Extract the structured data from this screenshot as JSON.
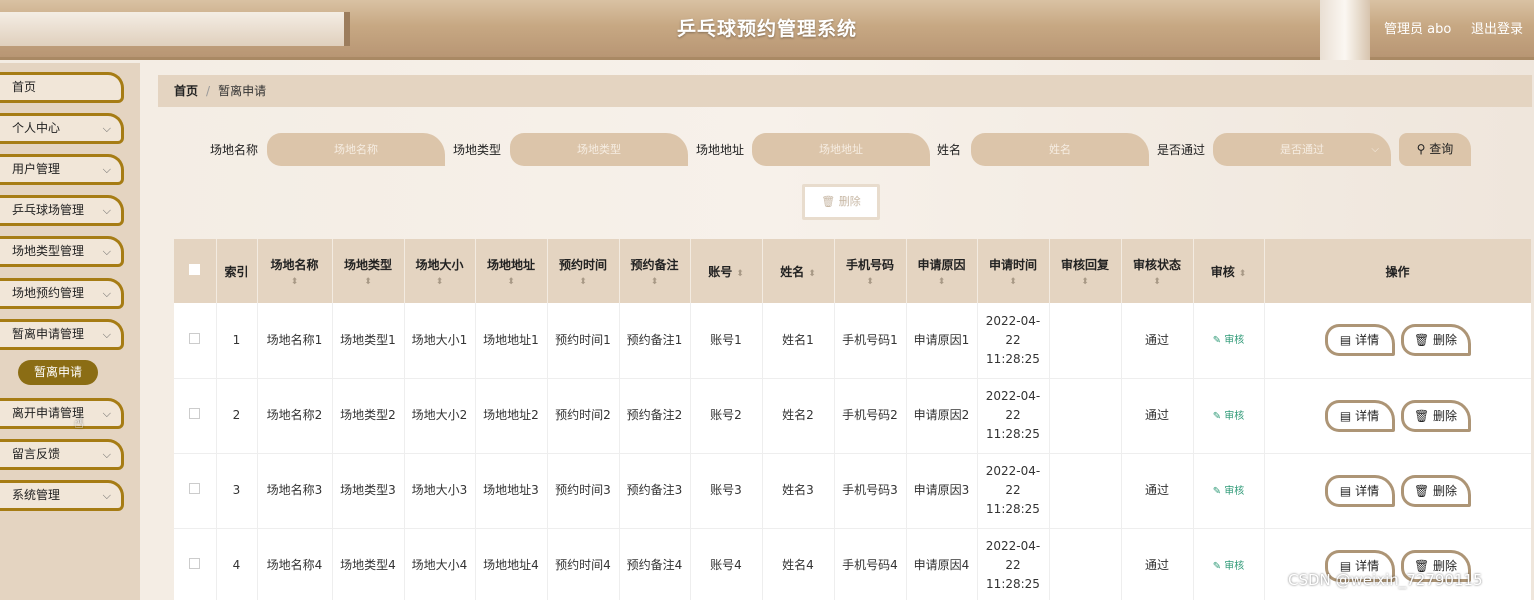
{
  "header": {
    "title": "乒乓球预约管理系统",
    "user": "管理员 abo",
    "logout": "退出登录"
  },
  "sidebar": {
    "items": [
      {
        "label": "首页",
        "chevron": false
      },
      {
        "label": "个人中心",
        "chevron": true
      },
      {
        "label": "用户管理",
        "chevron": true
      },
      {
        "label": "乒乓球场管理",
        "chevron": true
      },
      {
        "label": "场地类型管理",
        "chevron": true
      },
      {
        "label": "场地预约管理",
        "chevron": true
      },
      {
        "label": "暂离申请管理",
        "chevron": true
      },
      {
        "label": "离开申请管理",
        "chevron": true
      },
      {
        "label": "留言反馈",
        "chevron": true
      },
      {
        "label": "系统管理",
        "chevron": true
      }
    ],
    "active_sub": "暂离申请"
  },
  "breadcrumb": {
    "home": "首页",
    "separator": "/",
    "current": "暂离申请"
  },
  "search": {
    "fields": [
      {
        "label": "场地名称",
        "placeholder": "场地名称"
      },
      {
        "label": "场地类型",
        "placeholder": "场地类型"
      },
      {
        "label": "场地地址",
        "placeholder": "场地地址"
      },
      {
        "label": "姓名",
        "placeholder": "姓名"
      }
    ],
    "select": {
      "label": "是否通过",
      "placeholder": "是否通过"
    },
    "query_button": "查询"
  },
  "delete_button": "删除",
  "table": {
    "columns": [
      "索引",
      "场地名称",
      "场地类型",
      "场地大小",
      "场地地址",
      "预约时间",
      "预约备注",
      "账号",
      "姓名",
      "手机号码",
      "申请原因",
      "申请时间",
      "审核回复",
      "审核状态",
      "审核",
      "操作"
    ],
    "rows": [
      {
        "index": "1",
        "name": "场地名称1",
        "type": "场地类型1",
        "size": "场地大小1",
        "address": "场地地址1",
        "time": "预约时间1",
        "note": "预约备注1",
        "account": "账号1",
        "person": "姓名1",
        "phone": "手机号码1",
        "reason": "申请原因1",
        "apply_time": "2022-04-22 11:28:25",
        "reply": "",
        "status": "通过"
      },
      {
        "index": "2",
        "name": "场地名称2",
        "type": "场地类型2",
        "size": "场地大小2",
        "address": "场地地址2",
        "time": "预约时间2",
        "note": "预约备注2",
        "account": "账号2",
        "person": "姓名2",
        "phone": "手机号码2",
        "reason": "申请原因2",
        "apply_time": "2022-04-22 11:28:25",
        "reply": "",
        "status": "通过"
      },
      {
        "index": "3",
        "name": "场地名称3",
        "type": "场地类型3",
        "size": "场地大小3",
        "address": "场地地址3",
        "time": "预约时间3",
        "note": "预约备注3",
        "account": "账号3",
        "person": "姓名3",
        "phone": "手机号码3",
        "reason": "申请原因3",
        "apply_time": "2022-04-22 11:28:25",
        "reply": "",
        "status": "通过"
      },
      {
        "index": "4",
        "name": "场地名称4",
        "type": "场地类型4",
        "size": "场地大小4",
        "address": "场地地址4",
        "time": "预约时间4",
        "note": "预约备注4",
        "account": "账号4",
        "person": "姓名4",
        "phone": "手机号码4",
        "reason": "申请原因4",
        "apply_time": "2022-04-22 11:28:25",
        "reply": "",
        "status": "通过"
      }
    ],
    "audit_link": "审核",
    "detail_button": "详情",
    "row_delete_button": "删除"
  },
  "watermark": "CSDN @weixin_72790115",
  "colors": {
    "accent": "#a67c14",
    "sub_active": "#8b6d14",
    "panel": "#e4d4c1",
    "input_bg": "#dcc5aa",
    "audit": "#2f9a77"
  }
}
